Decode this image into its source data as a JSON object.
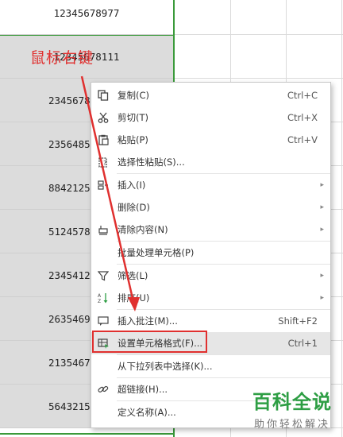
{
  "sheet": {
    "cells": [
      "12345678977",
      "12345678111",
      "2345678",
      "2356485",
      "8842125",
      "5124578",
      "2345412",
      "2635469",
      "2135467",
      "5643215"
    ]
  },
  "annotation": {
    "text": "鼠标右键"
  },
  "menu": {
    "items": [
      {
        "label": "复制(C)",
        "shortcut": "Ctrl+C",
        "icon": "copy-icon"
      },
      {
        "label": "剪切(T)",
        "shortcut": "Ctrl+X",
        "icon": "cut-icon"
      },
      {
        "label": "粘贴(P)",
        "shortcut": "Ctrl+V",
        "icon": "paste-icon"
      },
      {
        "label": "选择性粘贴(S)...",
        "icon": "paste-special-icon"
      },
      {
        "label": "插入(I)",
        "icon": "insert-icon"
      },
      {
        "label": "删除(D)",
        "icon": ""
      },
      {
        "label": "清除内容(N)",
        "icon": "eraser-icon"
      },
      {
        "label": "批量处理单元格(P)",
        "icon": ""
      },
      {
        "label": "筛选(L)",
        "icon": "filter-icon"
      },
      {
        "label": "排序(U)",
        "icon": "sort-icon"
      },
      {
        "label": "插入批注(M)...",
        "shortcut": "Shift+F2",
        "icon": "comment-icon"
      },
      {
        "label": "设置单元格格式(F)...",
        "shortcut": "Ctrl+1",
        "icon": "format-cells-icon"
      },
      {
        "label": "从下拉列表中选择(K)...",
        "icon": ""
      },
      {
        "label": "超链接(H)...",
        "icon": "link-icon"
      },
      {
        "label": "定义名称(A)...",
        "icon": ""
      }
    ]
  },
  "watermark": {
    "title": "百科全说",
    "subtitle": "助你轻松解决"
  },
  "colors": {
    "accent_green": "#2e9e44",
    "annotation_red": "#e0302f",
    "selection_border": "#3a9a3a"
  }
}
